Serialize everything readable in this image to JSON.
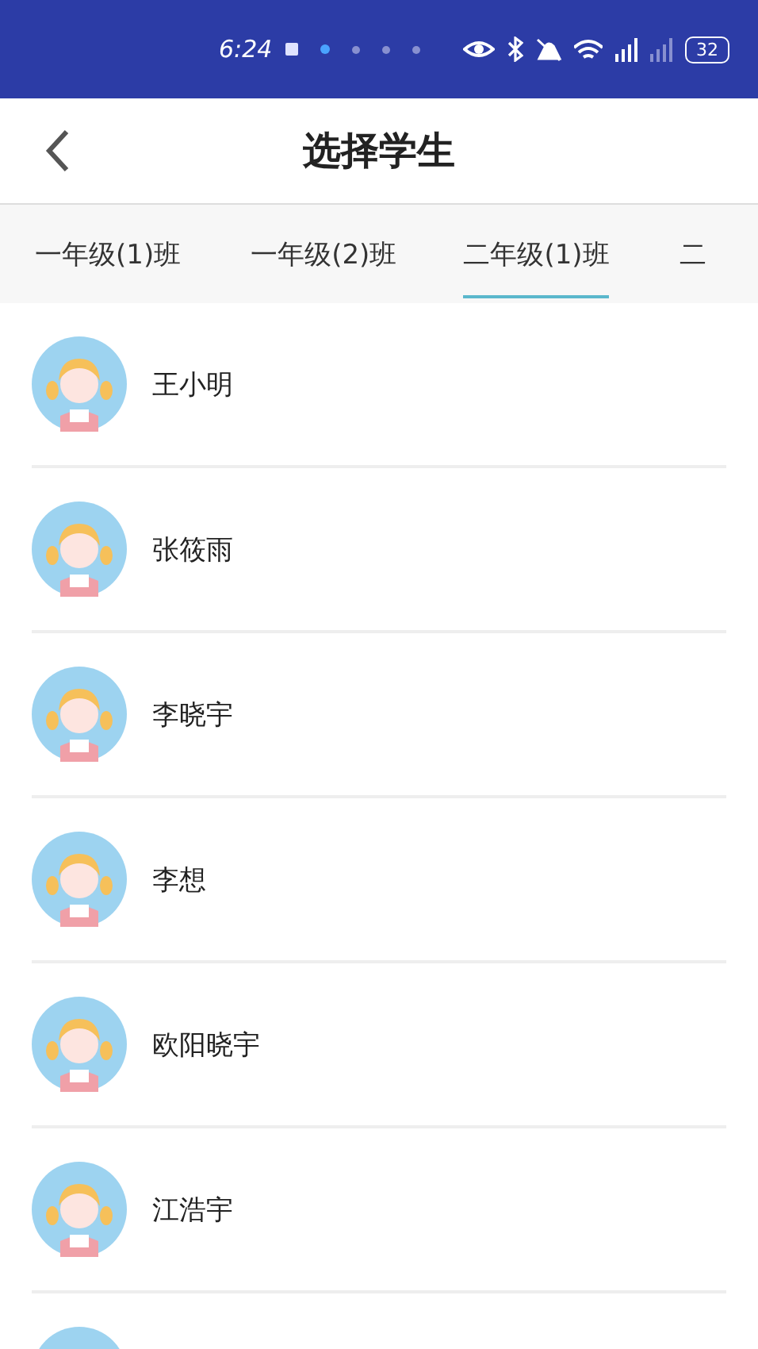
{
  "status_bar": {
    "time": "6:24",
    "battery": "32"
  },
  "header": {
    "title": "选择学生"
  },
  "tabs": [
    {
      "label": "一年级(1)班",
      "selected": false
    },
    {
      "label": "一年级(2)班",
      "selected": false
    },
    {
      "label": "二年级(1)班",
      "selected": true
    },
    {
      "label": "二",
      "selected": false
    }
  ],
  "students": [
    {
      "name": "王小明"
    },
    {
      "name": "张筱雨"
    },
    {
      "name": "李晓宇"
    },
    {
      "name": "李想"
    },
    {
      "name": "欧阳晓宇"
    },
    {
      "name": "江浩宇"
    }
  ]
}
